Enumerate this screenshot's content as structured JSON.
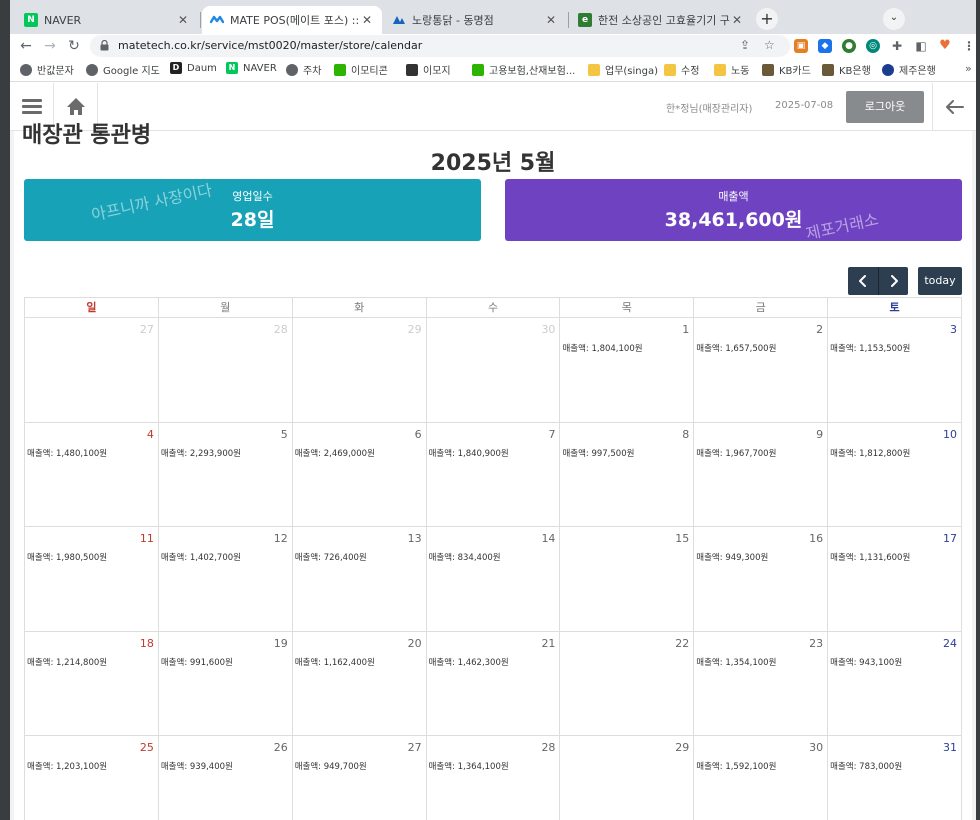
{
  "tabs": [
    {
      "title": "NAVER",
      "favicon_color": "#03c75a",
      "favicon_letter": "N"
    },
    {
      "title": "MATE POS(메이트 포스) :: 매장관리",
      "favicon_color": "#1e88e5",
      "favicon_letter": ""
    },
    {
      "title": "노랑통닭 - 동명점",
      "favicon_color": "#1565c0",
      "favicon_letter": ""
    },
    {
      "title": "한전 소상공인 고효율기기 구매지원",
      "favicon_color": "#2e7d32",
      "favicon_letter": ""
    }
  ],
  "toolbar": {
    "url": "matetech.co.kr/service/mst0020/master/store/calendar"
  },
  "bookmarks": [
    {
      "label": "반값문자",
      "color": "#5f6368"
    },
    {
      "label": "Google 지도",
      "color": "#5f6368"
    },
    {
      "label": "Daum",
      "color": "#222222",
      "letter": "D"
    },
    {
      "label": "NAVER",
      "color": "#03c75a",
      "letter": "N"
    },
    {
      "label": "주차",
      "color": "#5f6368"
    },
    {
      "label": "이모티콘",
      "color": "#2db400"
    },
    {
      "label": "이모지",
      "color": "#333333"
    },
    {
      "label": "고용보험,산재보험...",
      "color": "#2db400"
    },
    {
      "label": "업무(singa)",
      "color": "#f4c542"
    },
    {
      "label": "수정",
      "color": "#f4c542"
    },
    {
      "label": "노동",
      "color": "#f4c542"
    },
    {
      "label": "KB카드",
      "color": "#6b5a3a"
    },
    {
      "label": "KB은행",
      "color": "#6b5a3a"
    },
    {
      "label": "제주은행",
      "color": "#1a3d8f"
    }
  ],
  "header": {
    "user": "한*정님(매장관리자)",
    "date": "2025-07-08",
    "logout_label": "로그아웃"
  },
  "page": {
    "partial_title": "매장관 통관병",
    "month_title": "2025년 5월",
    "cards": {
      "days_label": "영업일수",
      "days_value": "28일",
      "sales_label": "매출액",
      "sales_value": "38,461,600원",
      "watermark_left": "아프니까 사장이다",
      "watermark_right": "제포거래소"
    },
    "today_label": "today"
  },
  "colors": {
    "card_teal": "#17a2b8",
    "card_purple": "#6f42c1",
    "nav_button": "#2c3e50"
  },
  "calendar": {
    "weekdays": [
      "일",
      "월",
      "화",
      "수",
      "목",
      "금",
      "토"
    ],
    "weeks": [
      [
        {
          "day": "27",
          "other": true
        },
        {
          "day": "28",
          "other": true
        },
        {
          "day": "29",
          "other": true
        },
        {
          "day": "30",
          "other": true
        },
        {
          "day": "1",
          "sales": "매출액: 1,804,100원"
        },
        {
          "day": "2",
          "sales": "매출액: 1,657,500원"
        },
        {
          "day": "3",
          "sales": "매출액: 1,153,500원"
        }
      ],
      [
        {
          "day": "4",
          "sales": "매출액: 1,480,100원"
        },
        {
          "day": "5",
          "sales": "매출액: 2,293,900원"
        },
        {
          "day": "6",
          "sales": "매출액: 2,469,000원"
        },
        {
          "day": "7",
          "sales": "매출액: 1,840,900원"
        },
        {
          "day": "8",
          "sales": "매출액: 997,500원"
        },
        {
          "day": "9",
          "sales": "매출액: 1,967,700원"
        },
        {
          "day": "10",
          "sales": "매출액: 1,812,800원"
        }
      ],
      [
        {
          "day": "11",
          "sales": "매출액: 1,980,500원"
        },
        {
          "day": "12",
          "sales": "매출액: 1,402,700원"
        },
        {
          "day": "13",
          "sales": "매출액: 726,400원"
        },
        {
          "day": "14",
          "sales": "매출액: 834,400원"
        },
        {
          "day": "15",
          "sales": ""
        },
        {
          "day": "16",
          "sales": "매출액: 949,300원"
        },
        {
          "day": "17",
          "sales": "매출액: 1,131,600원"
        }
      ],
      [
        {
          "day": "18",
          "sales": "매출액: 1,214,800원"
        },
        {
          "day": "19",
          "sales": "매출액: 991,600원"
        },
        {
          "day": "20",
          "sales": "매출액: 1,162,400원"
        },
        {
          "day": "21",
          "sales": "매출액: 1,462,300원"
        },
        {
          "day": "22",
          "sales": ""
        },
        {
          "day": "23",
          "sales": "매출액: 1,354,100원"
        },
        {
          "day": "24",
          "sales": "매출액: 943,100원"
        }
      ],
      [
        {
          "day": "25",
          "sales": "매출액: 1,203,100원"
        },
        {
          "day": "26",
          "sales": "매출액: 939,400원"
        },
        {
          "day": "27",
          "sales": "매출액: 949,700원"
        },
        {
          "day": "28",
          "sales": "매출액: 1,364,100원"
        },
        {
          "day": "29",
          "sales": ""
        },
        {
          "day": "30",
          "sales": "매출액: 1,592,100원"
        },
        {
          "day": "31",
          "sales": "매출액: 783,000원"
        }
      ]
    ]
  }
}
